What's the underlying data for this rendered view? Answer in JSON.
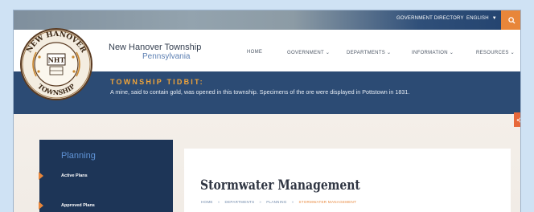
{
  "utility": {
    "government_directory": "GOVERNMENT DIRECTORY",
    "language": "ENGLISH",
    "language_caret": "▼"
  },
  "header": {
    "site_name": "New Hanover Township",
    "site_state": "Pennsylvania",
    "logo": {
      "top_text": "NEW HANOVER",
      "bottom_text": "TOWNSHIP",
      "badge": "NHT"
    }
  },
  "nav": {
    "home": "HOME",
    "government": "GOVERNMENT ⌄",
    "departments": "DEPARTMENTS ⌄",
    "information": "INFORMATION ⌄",
    "resources": "RESOURCES ⌄"
  },
  "tidbit": {
    "title": "TOWNSHIP TIDBIT:",
    "text": "A mine, said to contain gold, was opened in this township. Specimens of the ore were displayed in Pottstown in 1831."
  },
  "sidebar": {
    "title": "Planning",
    "items": [
      {
        "label": "Active Plans"
      },
      {
        "label": "Approved Plans"
      }
    ]
  },
  "main": {
    "page_title": "Stormwater Management",
    "breadcrumb": [
      "HOME",
      "DEPARTMENTS",
      "PLANNING",
      "STORMWATER MANAGEMENT"
    ],
    "breadcrumb_separator": "»"
  },
  "colors": {
    "accent_orange": "#e8863a",
    "navy": "#2c4b74",
    "sidebar_navy": "#1d3557",
    "link_blue": "#5c7fb2"
  },
  "icons": {
    "search": "search-icon",
    "share": "share-icon"
  }
}
